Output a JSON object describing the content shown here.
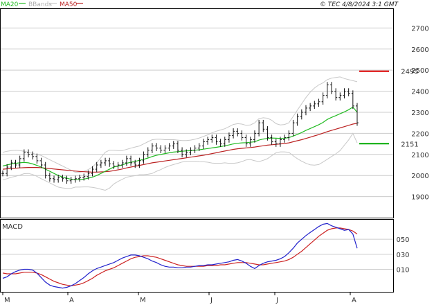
{
  "copyright": "© TEC 4/8/2024 3:1 GMT",
  "colors": {
    "ma20": "#22bb22",
    "bbands": "#c8c8c8",
    "ma50": "#bb2222",
    "price": "#111111",
    "macd": "#2222cc",
    "signal": "#cc2222",
    "grid": "#cccccc",
    "resistance": "#dd0000",
    "support": "#00aa00"
  },
  "chart_data": [
    {
      "type": "line",
      "title": "",
      "legend": [
        {
          "name": "MA20",
          "color": "#22bb22"
        },
        {
          "name": "BBands",
          "color": "#c8c8c8"
        },
        {
          "name": "MA50",
          "color": "#bb2222"
        }
      ],
      "y_ticks": [
        1900,
        2000,
        2100,
        2200,
        2300,
        2400,
        2500,
        2600,
        2700
      ],
      "ylim": [
        1800,
        2790
      ],
      "x_ticks": [
        "M",
        "A",
        "M",
        "J",
        "J",
        "A"
      ],
      "grid": true,
      "levels": [
        {
          "label": "2495",
          "value": 2495,
          "color": "#dd0000"
        },
        {
          "label": "2151",
          "value": 2151,
          "color": "#00aa00"
        }
      ],
      "series": [
        {
          "name": "Price",
          "values": [
            2010,
            2040,
            2060,
            2050,
            2080,
            2110,
            2100,
            2090,
            2070,
            2050,
            2000,
            1985,
            1980,
            1990,
            1985,
            1975,
            1980,
            1985,
            1990,
            1995,
            2010,
            2030,
            2050,
            2060,
            2070,
            2055,
            2045,
            2050,
            2060,
            2080,
            2060,
            2050,
            2070,
            2100,
            2120,
            2140,
            2130,
            2120,
            2130,
            2140,
            2150,
            2120,
            2100,
            2110,
            2120,
            2130,
            2140,
            2160,
            2170,
            2180,
            2160,
            2150,
            2170,
            2190,
            2210,
            2200,
            2180,
            2150,
            2170,
            2200,
            2250,
            2220,
            2180,
            2160,
            2150,
            2170,
            2180,
            2200,
            2250,
            2280,
            2300,
            2320,
            2330,
            2340,
            2350,
            2380,
            2430,
            2400,
            2370,
            2380,
            2400,
            2390,
            2330,
            2250
          ]
        },
        {
          "name": "MA20",
          "values": [
            2045,
            2050,
            2055,
            2058,
            2060,
            2062,
            2060,
            2055,
            2048,
            2040,
            2030,
            2020,
            2010,
            2000,
            1993,
            1987,
            1982,
            1980,
            1980,
            1983,
            1987,
            1992,
            2000,
            2010,
            2020,
            2030,
            2040,
            2045,
            2050,
            2058,
            2063,
            2067,
            2072,
            2077,
            2083,
            2090,
            2096,
            2100,
            2104,
            2108,
            2111,
            2113,
            2115,
            2117,
            2118,
            2120,
            2122,
            2125,
            2128,
            2131,
            2134,
            2137,
            2141,
            2145,
            2150,
            2153,
            2155,
            2156,
            2158,
            2160,
            2168,
            2173,
            2176,
            2178,
            2177,
            2176,
            2177,
            2180,
            2187,
            2195,
            2204,
            2214,
            2223,
            2232,
            2241,
            2252,
            2266,
            2276,
            2284,
            2293,
            2302,
            2312,
            2325,
            2300
          ]
        },
        {
          "name": "MA50",
          "values": [
            2030,
            2032,
            2034,
            2035,
            2036,
            2037,
            2038,
            2038,
            2038,
            2037,
            2035,
            2033,
            2031,
            2029,
            2027,
            2025,
            2023,
            2021,
            2019,
            2018,
            2017,
            2016,
            2016,
            2017,
            2018,
            2020,
            2023,
            2027,
            2031,
            2036,
            2040,
            2044,
            2048,
            2052,
            2056,
            2060,
            2063,
            2066,
            2069,
            2072,
            2075,
            2078,
            2081,
            2084,
            2087,
            2090,
            2093,
            2096,
            2100,
            2104,
            2108,
            2112,
            2116,
            2120,
            2124,
            2127,
            2129,
            2131,
            2133,
            2135,
            2138,
            2141,
            2144,
            2146,
            2148,
            2150,
            2152,
            2155,
            2160,
            2165,
            2170,
            2176,
            2182,
            2188,
            2194,
            2201,
            2208,
            2214,
            2220,
            2226,
            2232,
            2238,
            2244,
            2248
          ]
        },
        {
          "name": "BB Upper",
          "values": [
            2110,
            2115,
            2118,
            2120,
            2118,
            2115,
            2110,
            2105,
            2100,
            2095,
            2085,
            2075,
            2065,
            2055,
            2045,
            2035,
            2025,
            2015,
            2015,
            2020,
            2028,
            2040,
            2060,
            2085,
            2110,
            2120,
            2120,
            2118,
            2118,
            2124,
            2130,
            2135,
            2140,
            2150,
            2160,
            2170,
            2172,
            2172,
            2170,
            2170,
            2170,
            2168,
            2166,
            2166,
            2168,
            2172,
            2178,
            2185,
            2193,
            2203,
            2210,
            2216,
            2222,
            2232,
            2242,
            2246,
            2244,
            2238,
            2240,
            2250,
            2270,
            2274,
            2272,
            2262,
            2246,
            2240,
            2242,
            2250,
            2280,
            2310,
            2340,
            2370,
            2395,
            2415,
            2430,
            2440,
            2455,
            2462,
            2465,
            2468,
            2460,
            2455,
            2450,
            2445
          ]
        },
        {
          "name": "BB Lower",
          "values": [
            1980,
            1985,
            1992,
            1996,
            2002,
            2009,
            2010,
            2005,
            1996,
            1985,
            1975,
            1965,
            1955,
            1945,
            1941,
            1939,
            1939,
            1945,
            1945,
            1946,
            1946,
            1944,
            1940,
            1935,
            1930,
            1940,
            1960,
            1972,
            1982,
            1992,
            1996,
            1999,
            2004,
            2004,
            2006,
            2010,
            2020,
            2028,
            2038,
            2046,
            2052,
            2058,
            2064,
            2068,
            2068,
            2068,
            2066,
            2065,
            2063,
            2059,
            2058,
            2058,
            2060,
            2058,
            2058,
            2060,
            2066,
            2074,
            2076,
            2070,
            2066,
            2072,
            2080,
            2094,
            2108,
            2112,
            2112,
            2110,
            2094,
            2080,
            2068,
            2058,
            2051,
            2049,
            2052,
            2064,
            2077,
            2090,
            2103,
            2118,
            2144,
            2169,
            2200,
            2155
          ]
        }
      ]
    },
    {
      "type": "line",
      "title": "MACD",
      "y_ticks": [
        0.1,
        0.3,
        0.5
      ],
      "y_tick_labels": [
        "010",
        "030",
        "050"
      ],
      "ylim": [
        -0.2,
        0.76
      ],
      "x_ticks": [
        "M",
        "A",
        "M",
        "J",
        "J",
        "A"
      ],
      "grid": true,
      "series": [
        {
          "name": "MACD",
          "values": [
            -0.02,
            0.0,
            0.04,
            0.07,
            0.09,
            0.1,
            0.1,
            0.09,
            0.05,
            -0.01,
            -0.07,
            -0.11,
            -0.13,
            -0.14,
            -0.15,
            -0.14,
            -0.12,
            -0.09,
            -0.05,
            -0.01,
            0.04,
            0.08,
            0.11,
            0.13,
            0.15,
            0.17,
            0.19,
            0.22,
            0.25,
            0.27,
            0.29,
            0.29,
            0.28,
            0.26,
            0.24,
            0.21,
            0.19,
            0.16,
            0.14,
            0.13,
            0.13,
            0.12,
            0.12,
            0.13,
            0.13,
            0.14,
            0.15,
            0.15,
            0.16,
            0.16,
            0.17,
            0.18,
            0.19,
            0.2,
            0.22,
            0.23,
            0.21,
            0.18,
            0.14,
            0.11,
            0.15,
            0.18,
            0.2,
            0.21,
            0.22,
            0.24,
            0.27,
            0.32,
            0.38,
            0.45,
            0.5,
            0.55,
            0.59,
            0.63,
            0.67,
            0.7,
            0.71,
            0.68,
            0.66,
            0.64,
            0.62,
            0.63,
            0.57,
            0.38
          ]
        },
        {
          "name": "Signal",
          "values": [
            0.05,
            0.04,
            0.04,
            0.04,
            0.05,
            0.06,
            0.06,
            0.06,
            0.05,
            0.03,
            0.0,
            -0.03,
            -0.06,
            -0.08,
            -0.1,
            -0.11,
            -0.12,
            -0.11,
            -0.1,
            -0.08,
            -0.05,
            -0.02,
            0.02,
            0.05,
            0.08,
            0.1,
            0.12,
            0.15,
            0.18,
            0.21,
            0.24,
            0.26,
            0.27,
            0.28,
            0.28,
            0.27,
            0.26,
            0.24,
            0.22,
            0.2,
            0.18,
            0.16,
            0.15,
            0.14,
            0.14,
            0.14,
            0.14,
            0.14,
            0.15,
            0.15,
            0.15,
            0.16,
            0.16,
            0.17,
            0.18,
            0.19,
            0.19,
            0.19,
            0.18,
            0.17,
            0.16,
            0.16,
            0.17,
            0.18,
            0.19,
            0.2,
            0.21,
            0.23,
            0.26,
            0.3,
            0.34,
            0.39,
            0.44,
            0.49,
            0.54,
            0.58,
            0.62,
            0.64,
            0.65,
            0.65,
            0.64,
            0.63,
            0.61,
            0.57
          ]
        }
      ]
    }
  ]
}
